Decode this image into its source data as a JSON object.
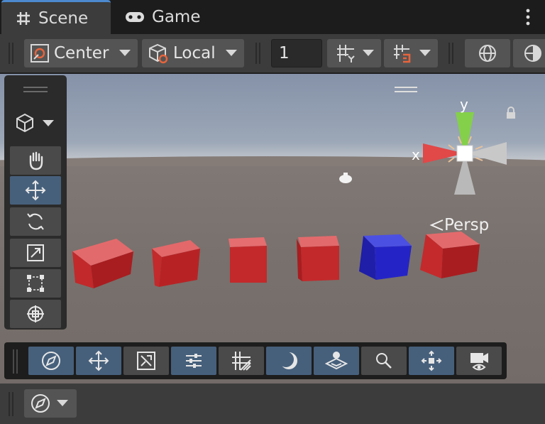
{
  "tabs": [
    {
      "label": "Scene",
      "icon": "hash-grid-icon",
      "active": true
    },
    {
      "label": "Game",
      "icon": "gamepad-icon",
      "active": false
    }
  ],
  "toolbar": {
    "pivot_label": "Center",
    "space_label": "Local",
    "snap_value": "1"
  },
  "viewport": {
    "persp_label": "Persp",
    "gizmo_axes": {
      "x": "x",
      "y": "y"
    }
  },
  "colors": {
    "accent_blue": "#46607c",
    "tab_highlight": "#4c89ce",
    "cube_red": "#c42a2c",
    "cube_blue": "#2424c6"
  }
}
